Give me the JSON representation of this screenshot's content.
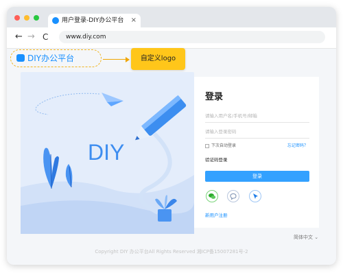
{
  "tab": {
    "title": "用户登录-DIY办公平台",
    "close": "×"
  },
  "nav": {
    "back": "←",
    "forward": "→",
    "reload": "C"
  },
  "address": {
    "url": "www.diy.com"
  },
  "logo": {
    "text": "DIY办公平台"
  },
  "annotation": {
    "label": "自定义logo"
  },
  "illustration": {
    "text": "DIY"
  },
  "login": {
    "title": "登录",
    "username_placeholder": "请输入用户名/手机号/邮箱",
    "password_placeholder": "请输入登录密码",
    "remember_label": "下次自动登录",
    "forgot_link": "忘记密码？",
    "sms_login": "验证码登录",
    "submit": "登录",
    "register": "新用户注册"
  },
  "language": {
    "label": "简体中文 ⌄"
  },
  "footer": {
    "text": "Copyright    DIY 办公平台All Rights Reserved 湘ICP备15007281号-2"
  },
  "colors": {
    "accent": "#1890ff",
    "badge": "#ffc61a",
    "button": "#33a1ff"
  }
}
